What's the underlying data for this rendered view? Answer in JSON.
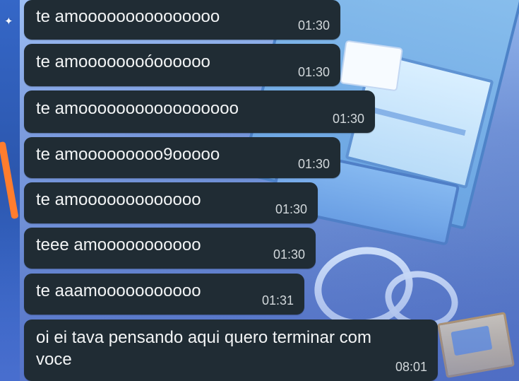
{
  "wallpaper": {
    "colors": {
      "base_top": "#90b6f3",
      "base_mid": "#6f93de",
      "base_bottom": "#4f73c9",
      "bubble": "#202c34",
      "text": "#f2f4f5",
      "time": "#d2d8db"
    }
  },
  "chat": {
    "leading_icon": "star-icon",
    "messages": [
      {
        "text": "te amooooooooooooooo",
        "time": "01:30"
      },
      {
        "text": "te amoooooooóoooooo",
        "time": "01:30"
      },
      {
        "text": "te amooooooooooooooooo",
        "time": "01:30"
      },
      {
        "text": "te amooooooooo9ooooo",
        "time": "01:30"
      },
      {
        "text": "te amooooooooooooo",
        "time": "01:30"
      },
      {
        "text": "teee amooooooooooo",
        "time": "01:30"
      },
      {
        "text": "te aaamooooooooooo",
        "time": "01:31"
      },
      {
        "text": "oi ei tava pensando aqui quero terminar com voce",
        "time": "08:01"
      }
    ]
  }
}
